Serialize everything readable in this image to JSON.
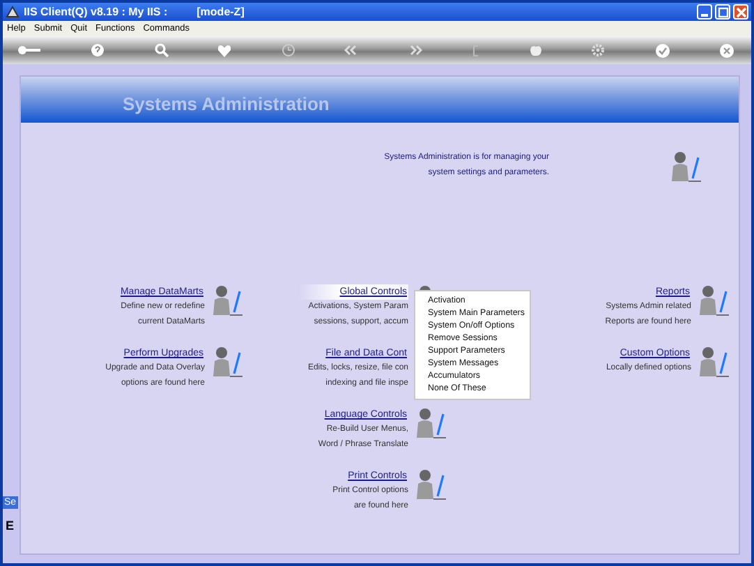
{
  "window": {
    "title": "IIS Client(Q) v8.19 : My IIS :",
    "mode": "[mode-Z]"
  },
  "menu": [
    "Help",
    "Submit",
    "Quit",
    "Functions",
    "Commands"
  ],
  "banner": {
    "title": "Systems Administration"
  },
  "intro": [
    "Systems Administration is for managing your",
    "system settings and parameters."
  ],
  "columns": [
    {
      "items": [
        {
          "link": "Manage DataMarts",
          "highlighted": false,
          "lines": [
            "Define new or redefine",
            "current DataMarts"
          ]
        },
        {
          "link": "Perform Upgrades",
          "highlighted": false,
          "lines": [
            "Upgrade and Data Overlay",
            "options are found here"
          ]
        }
      ]
    },
    {
      "items": [
        {
          "link": "Global Controls",
          "highlighted": true,
          "lines": [
            "Activations, System Param",
            "sessions, support, accum"
          ]
        },
        {
          "link": "File and Data Cont",
          "highlighted": false,
          "lines": [
            "Edits, locks, resize, file con",
            "indexing and file inspe"
          ]
        },
        {
          "link": "Language Controls",
          "highlighted": false,
          "lines": [
            "Re-Build User Menus,",
            "Word / Phrase Translate"
          ]
        },
        {
          "link": "Print Controls",
          "highlighted": false,
          "lines": [
            "Print Control options",
            "are found here"
          ]
        }
      ]
    },
    {
      "items": [
        {
          "link": "Reports",
          "highlighted": false,
          "lines": [
            "Systems Admin related",
            "Reports are found here"
          ]
        },
        {
          "link": "Custom Options",
          "highlighted": false,
          "lines": [
            "Locally defined options"
          ]
        }
      ]
    }
  ],
  "dropdown": {
    "items": [
      "Activation",
      "System Main Parameters",
      "System On/off Options",
      "Remove Sessions",
      "Support Parameters",
      "System Messages",
      "Accumulators",
      "None Of These"
    ]
  },
  "side_tab": "Se",
  "side_letter": "E"
}
